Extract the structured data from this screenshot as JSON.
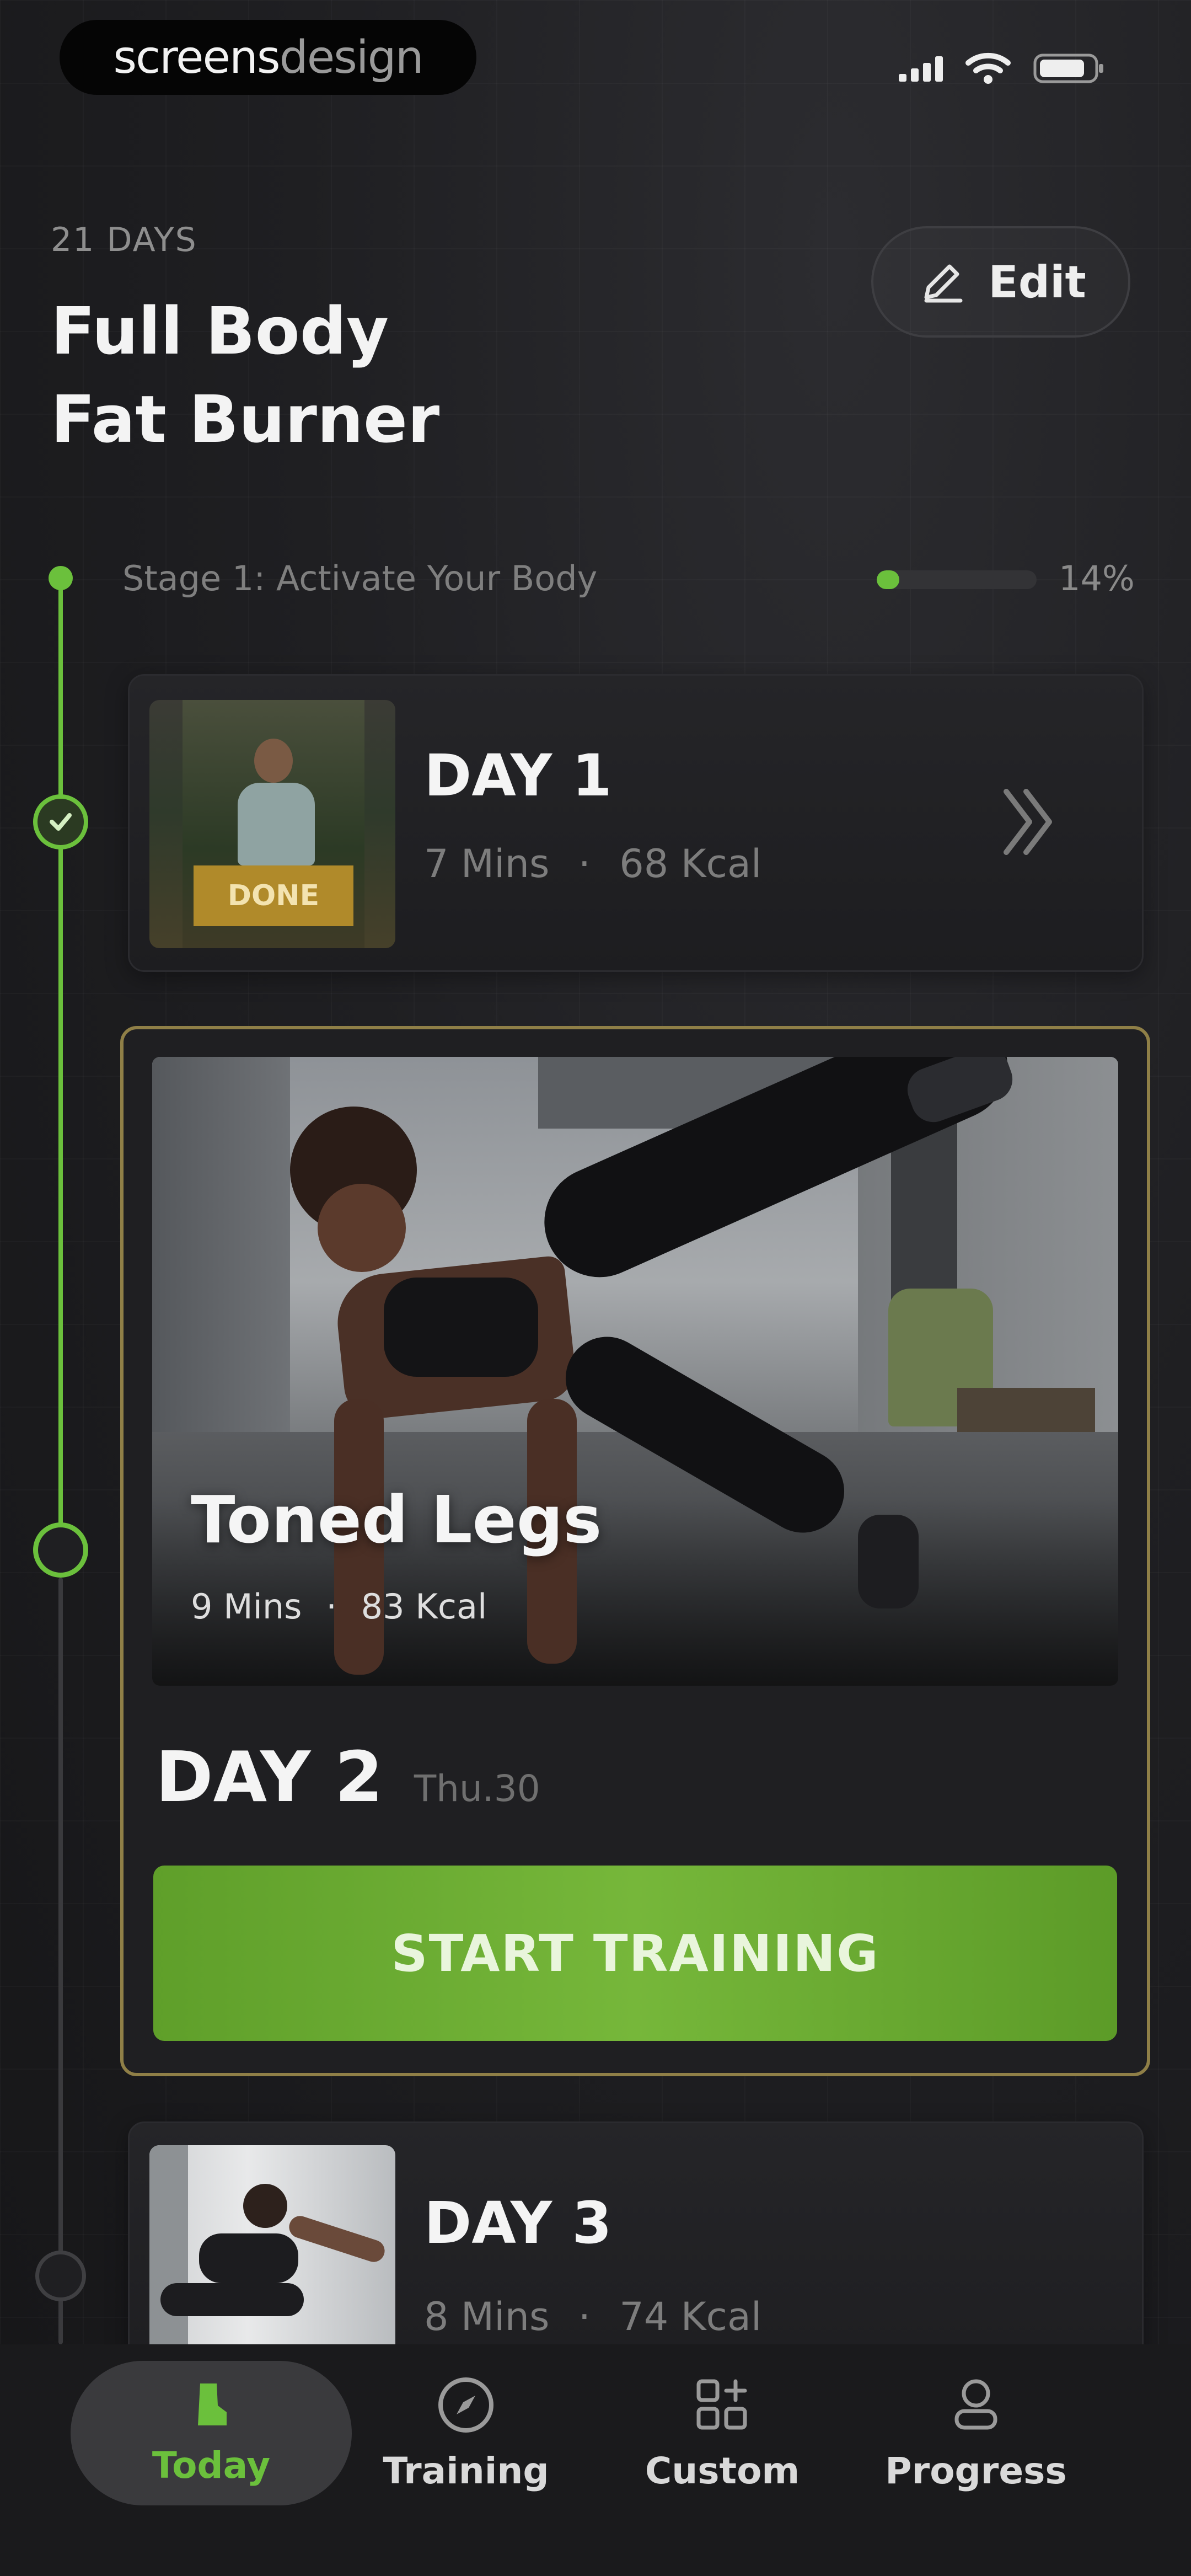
{
  "status_bar": {
    "brand_bold": "screens",
    "brand_light": "design"
  },
  "header": {
    "days_label": "21 DAYS",
    "title_line1": "Full Body",
    "title_line2": "Fat Burner",
    "edit_label": "Edit"
  },
  "stage": {
    "label": "Stage 1: Activate Your Body",
    "progress_percent_text": "14%",
    "progress_fraction": 0.14
  },
  "days": [
    {
      "title": "DAY 1",
      "mins": "7 Mins",
      "kcal": "68 Kcal",
      "thumb_badge": "DONE"
    },
    {
      "title": "DAY 2",
      "date": "Thu.30",
      "workout_name": "Toned Legs",
      "mins": "9 Mins",
      "kcal": "83 Kcal",
      "cta": "START TRAINING"
    },
    {
      "title": "DAY 3",
      "mins": "8 Mins",
      "kcal": "74 Kcal"
    }
  ],
  "meta_separator": "·",
  "nav": {
    "items": [
      {
        "label": "Today",
        "icon": "shoe-icon",
        "active": true
      },
      {
        "label": "Training",
        "icon": "compass-icon",
        "active": false
      },
      {
        "label": "Custom",
        "icon": "grid-plus-icon",
        "active": false
      },
      {
        "label": "Progress",
        "icon": "progress-icon",
        "active": false
      }
    ]
  },
  "colors": {
    "accent_green": "#6bc03c",
    "gold_border": "#8f7f47",
    "background": "#1f1f22"
  }
}
